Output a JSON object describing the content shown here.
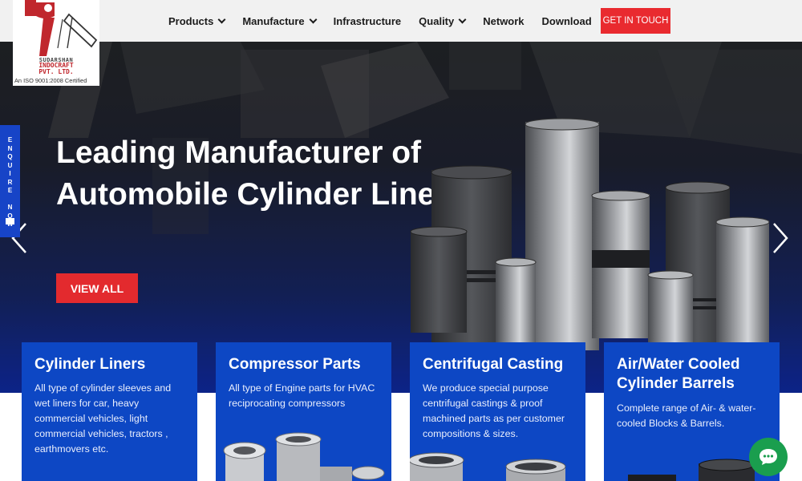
{
  "logo": {
    "line1": "SUDARSHAN",
    "line2": "INDOCRAFT",
    "line3": "PVT. LTD.",
    "certification": "An ISO 9001:2008 Certified"
  },
  "nav": {
    "items": [
      {
        "label": "Products",
        "has_dropdown": true
      },
      {
        "label": "Manufacture",
        "has_dropdown": true
      },
      {
        "label": "Infrastructure",
        "has_dropdown": false
      },
      {
        "label": "Quality",
        "has_dropdown": true
      },
      {
        "label": "Network",
        "has_dropdown": false
      },
      {
        "label": "Download",
        "has_dropdown": false
      }
    ],
    "cta_label": "GET IN TOUCH"
  },
  "enquire": {
    "label": "E\nN\nQ\nU\nI\nR\nE\n\nN\nO\nW",
    "icon": "mail-icon"
  },
  "hero": {
    "heading": "Leading Manufacturer of Automobile Cylinder Liners",
    "button_label": "VIEW ALL",
    "prev_icon": "chevron-left-icon",
    "next_icon": "chevron-right-icon"
  },
  "cards": [
    {
      "title": "Cylinder Liners",
      "description": "All type of cylinder sleeves and wet liners for car, heavy commercial vehicles, light commercial vehicles, tractors , earthmovers etc."
    },
    {
      "title": "Compressor Parts",
      "description": "All type of Engine parts for HVAC reciprocating compressors"
    },
    {
      "title": "Centrifugal Casting",
      "description": "We produce special purpose centrifugal castings & proof machined parts as per customer compositions & sizes."
    },
    {
      "title": "Air/Water Cooled Cylinder Barrels",
      "description": "Complete range of Air- & water-cooled Blocks & Barrels."
    }
  ],
  "colors": {
    "accent_red": "#e92a2f",
    "card_blue": "#0d47c4",
    "enquire_blue": "#1744c7",
    "chat_green": "#1a9e4e"
  },
  "chat": {
    "icon": "chat-bubble-icon"
  }
}
